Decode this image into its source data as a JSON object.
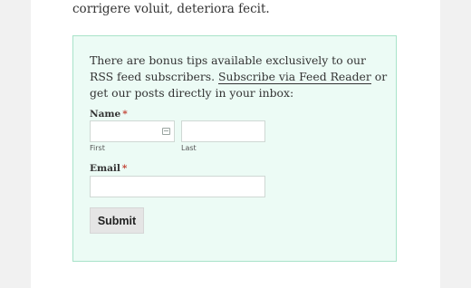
{
  "article": {
    "intro_line": "corrigere voluit, deteriora fecit."
  },
  "optin": {
    "text_before": "There are bonus tips available exclusively to our RSS feed subscribers.",
    "link_text": "Subscribe via Feed Reader",
    "text_after": "or get our posts directly in your inbox:",
    "name_label": "Name",
    "email_label": "Email",
    "required_mark": "*",
    "first_sublabel": "First",
    "last_sublabel": "Last",
    "first_value": "",
    "last_value": "",
    "email_value": "",
    "submit_label": "Submit",
    "card_icon": "contact-card-icon"
  },
  "colors": {
    "box_background": "#ecfbf5",
    "box_border": "#a8e3c9",
    "required": "#c0392b",
    "button_background": "#e5e5e5"
  }
}
